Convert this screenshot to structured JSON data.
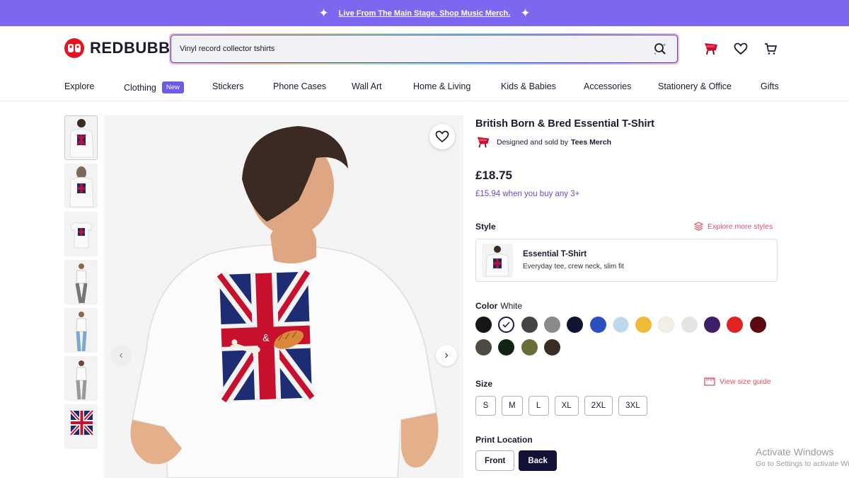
{
  "promo": {
    "text": "Live From The Main Stage. Shop Music Merch."
  },
  "header": {
    "logo_text": "REDBUBBLE",
    "search": {
      "value": "Vinyl record collector tshirts"
    }
  },
  "nav": {
    "items": [
      {
        "label": "Explore"
      },
      {
        "label": "Clothing",
        "badge": "New"
      },
      {
        "label": "Stickers"
      },
      {
        "label": "Phone Cases"
      },
      {
        "label": "Wall Art"
      },
      {
        "label": "Home & Living"
      },
      {
        "label": "Kids & Babies"
      },
      {
        "label": "Accessories"
      },
      {
        "label": "Stationery & Office"
      },
      {
        "label": "Gifts"
      }
    ]
  },
  "product": {
    "title": "British Born & Bred Essential T-Shirt",
    "seller_prefix": "Designed and sold by",
    "seller_name": "Tees Merch",
    "price": "£18.75",
    "bulk_price": "£15.94 when you buy any 3+",
    "style_label": "Style",
    "explore_styles": "Explore more styles",
    "style_card": {
      "name": "Essential T-Shirt",
      "desc": "Everyday tee, crew neck, slim fit"
    },
    "color_label": "Color",
    "color_selected": "White",
    "colors": [
      "#161616",
      "#ffffff",
      "#444444",
      "#8a8a8a",
      "#0f1530",
      "#2a4fbf",
      "#bcd8ee",
      "#f0b93a",
      "#f4efe3",
      "#e4e4e0",
      "#3f1f6b",
      "#e02424",
      "#5a0a10",
      "#4f4a44",
      "#0f2414",
      "#6a6c3a",
      "#3a2e24"
    ],
    "size_label": "Size",
    "size_guide": "View size guide",
    "sizes": [
      "S",
      "M",
      "L",
      "XL",
      "2XL",
      "3XL"
    ],
    "print_location_label": "Print Location",
    "print_locations": [
      "Front",
      "Back"
    ]
  },
  "watermark": {
    "line1": "Activate Windows",
    "line2": "Go to Settings to activate Windows."
  }
}
